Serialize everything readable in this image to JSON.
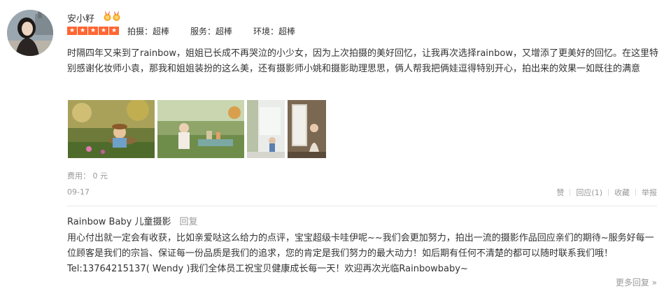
{
  "user": {
    "name": "安小籽",
    "avatar_icon": "avatar-photo"
  },
  "rating": {
    "stars": 5,
    "star_color": "#ff6633",
    "scores": [
      "拍摄：超棒",
      "服务：超棒",
      "环境：超棒"
    ]
  },
  "review": {
    "text": "时隔四年又来到了rainbow，姐姐已长成不再哭泣的小少女，因为上次拍摄的美好回忆，让我再次选择rainbow，又增添了更美好的回忆。在这里特别感谢化妆师小袁，那我和姐姐装扮的这么美，还有摄影师小姚和摄影助理思思，俩人帮我把俩娃逗得特别开心，拍出来的效果一如既往的满意",
    "photos": [
      "photo-kid-bench",
      "photo-girl-garden",
      "photo-child-room",
      "photo-child-window"
    ],
    "fee": "费用： 0 元",
    "date": "09-17"
  },
  "actions": {
    "like": "赞",
    "reply": "回应(1)",
    "collect": "收藏",
    "report": "举报"
  },
  "merchant_reply": {
    "name": "Rainbow Baby 儿童摄影",
    "reply_link": "回复",
    "text": "用心付出就一定会有收获，比如亲爱哒这么给力的点评，宝宝超级卡哇伊呢~~我们会更加努力，拍出一流的摄影作品回应亲们的期待~服务好每一位顾客是我们的宗旨、保证每一份品质是我们的追求，您的肯定是我们努力的最大动力！如后期有任何不清楚的都可以随时联系我们哦！Tel:13764215137( Wendy )我们全体员工祝宝贝健康成长每一天！欢迎再次光临Rainbowbaby~"
  },
  "more_replies": "更多回复 »"
}
